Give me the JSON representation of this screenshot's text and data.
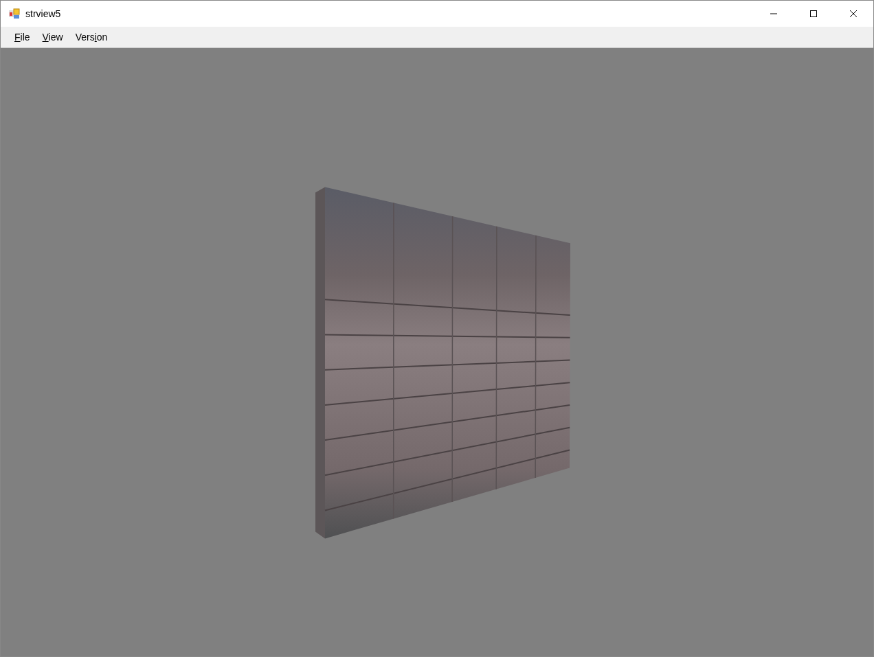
{
  "window": {
    "title": "strview5"
  },
  "menu": [
    {
      "key": "F",
      "post": "ile"
    },
    {
      "key": "V",
      "post": "iew"
    },
    {
      "pre": "Vers",
      "key": "i",
      "post": "on"
    }
  ]
}
